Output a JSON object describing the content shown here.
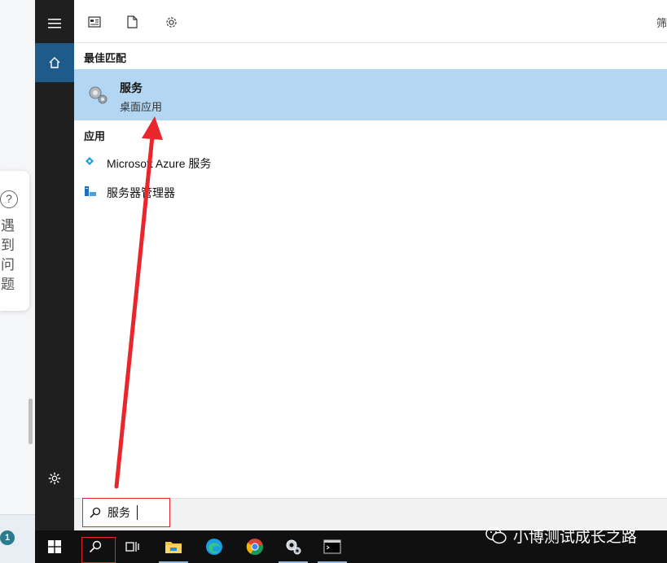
{
  "background": {
    "help_card": {
      "icon": "question-icon",
      "text": "遇到问题"
    },
    "badge_count": "1"
  },
  "rail": {
    "menu_icon": "hamburger-icon",
    "home_icon": "home-icon",
    "settings_icon": "gear-icon"
  },
  "toolbar": {
    "icons": [
      "news-icon",
      "document-icon",
      "gear-icon"
    ],
    "filter_label": "筛"
  },
  "best_match": {
    "section_label": "最佳匹配",
    "title": "服务",
    "subtitle": "桌面应用",
    "icon": "services-gear-icon"
  },
  "apps": {
    "section_label": "应用",
    "items": [
      {
        "label": "Microsoft Azure 服务",
        "icon": "azure-icon"
      },
      {
        "label": "服务器管理器",
        "icon": "server-manager-icon"
      }
    ]
  },
  "search": {
    "value": "服务",
    "icon": "search-icon"
  },
  "taskbar": {
    "items": [
      "windows-start-icon",
      "search-icon",
      "task-view-icon",
      "file-explorer-icon",
      "edge-icon",
      "chrome-icon",
      "settings-gear-icon",
      "terminal-icon"
    ]
  },
  "watermark": {
    "text": "小博测试成长之路"
  },
  "colors": {
    "accent": "#1e5a8a",
    "highlight": "#b3d7f2",
    "annotation_red": "#e8262b",
    "taskbar": "#101010"
  }
}
